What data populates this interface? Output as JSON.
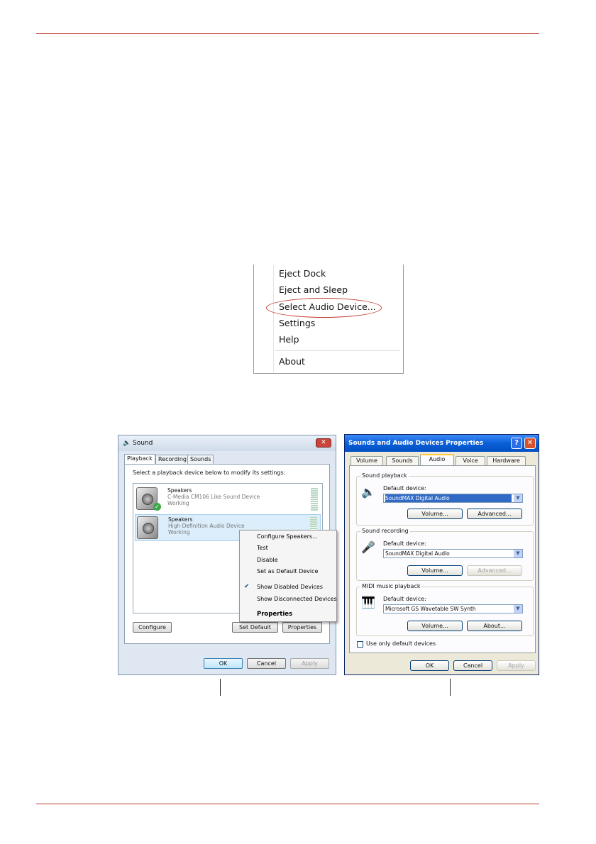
{
  "context_menu": {
    "items": [
      "Eject Dock",
      "Eject and Sleep",
      "Select Audio Device...",
      "Settings",
      "Help",
      "About"
    ],
    "highlighted": "Select Audio Device..."
  },
  "vista_dialog": {
    "title": "Sound",
    "tabs": [
      "Playback",
      "Recording",
      "Sounds"
    ],
    "prompt": "Select a playback device below to modify its settings:",
    "devices": [
      {
        "name": "Speakers",
        "description": "C-Media CM106 Like Sound Device",
        "status": "Working"
      },
      {
        "name": "Speakers",
        "description": "High Definition Audio Device",
        "status": "Working"
      }
    ],
    "popup_menu": [
      "Configure Speakers...",
      "Test",
      "Disable",
      "Set as Default Device",
      "Show Disabled Devices",
      "Show Disconnected Devices",
      "Properties"
    ],
    "buttons": {
      "configure": "Configure",
      "set_default": "Set Default",
      "properties": "Properties",
      "ok": "OK",
      "cancel": "Cancel",
      "apply": "Apply"
    }
  },
  "xp_dialog": {
    "title": "Sounds and Audio Devices Properties",
    "tabs": [
      "Volume",
      "Sounds",
      "Audio",
      "Voice",
      "Hardware"
    ],
    "groups": [
      {
        "label": "Sound playback",
        "device_label": "Default device:",
        "device": "SoundMAX Digital Audio",
        "btn1": "Volume...",
        "btn2": "Advanced..."
      },
      {
        "label": "Sound recording",
        "device_label": "Default device:",
        "device": "SoundMAX Digital Audio",
        "btn1": "Volume...",
        "btn2": "Advanced..."
      },
      {
        "label": "MIDI music playback",
        "device_label": "Default device:",
        "device": "Microsoft GS Wavetable SW Synth",
        "btn1": "Volume...",
        "btn2": "About..."
      }
    ],
    "checkbox_label": "Use only default devices",
    "buttons": {
      "ok": "OK",
      "cancel": "Cancel",
      "apply": "Apply"
    }
  }
}
